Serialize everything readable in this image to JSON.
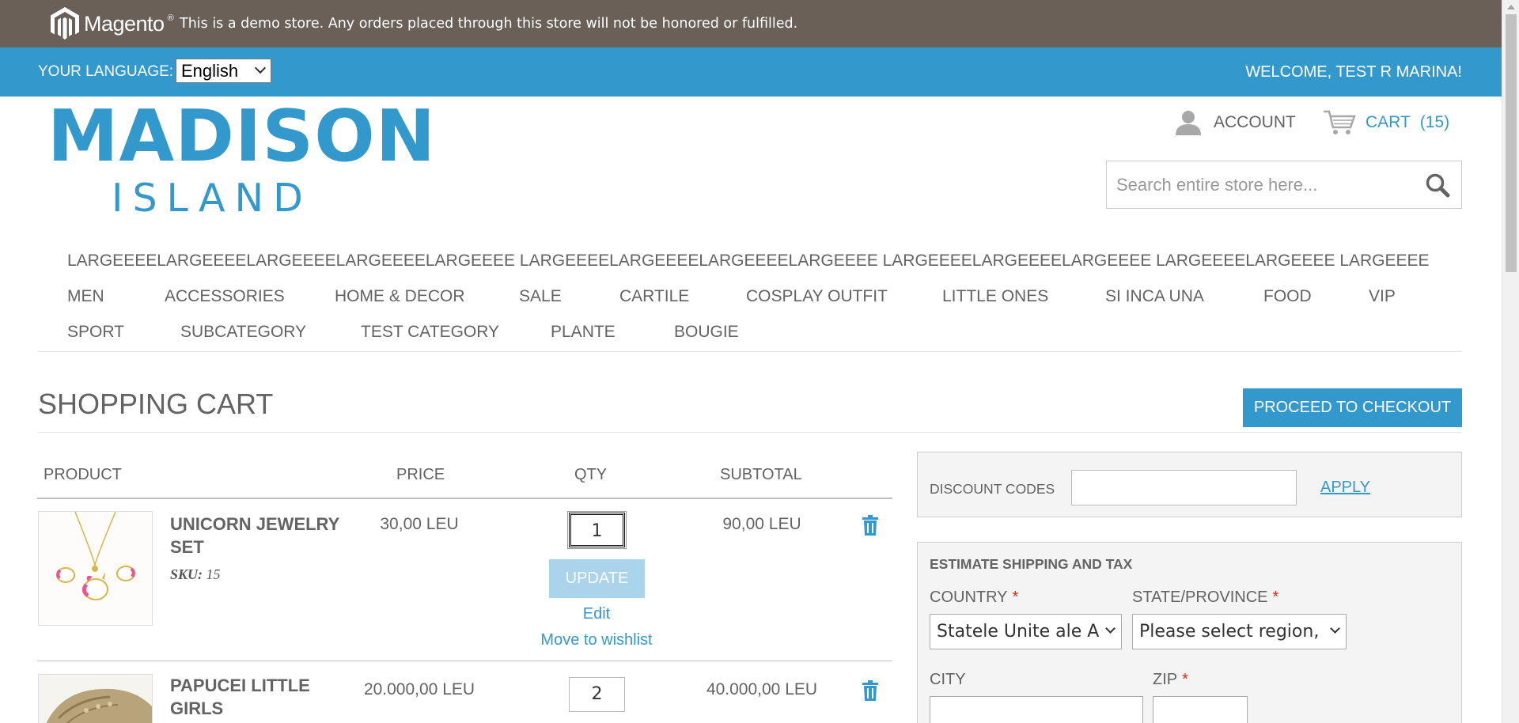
{
  "demo_notice": {
    "brand": "Magento",
    "text": "This is a demo store. Any orders placed through this store will not be honored or fulfilled."
  },
  "header_bar": {
    "language_label": "YOUR LANGUAGE:",
    "language_value": "English",
    "welcome": "WELCOME, TEST R MARINA!"
  },
  "logo": {
    "line1": "MADISON",
    "line2": "ISLAND"
  },
  "account": {
    "account_label": "ACCOUNT",
    "cart_label": "CART",
    "cart_count": "(15)"
  },
  "search": {
    "placeholder": "Search entire store here..."
  },
  "nav": {
    "row1": "LARGEEEELARGEEEELARGEEEELARGEEEELARGEEEE LARGEEEELARGEEEELARGEEEELARGEEEE LARGEEEELARGEEEELARGEEEE LARGEEEELARGEEEE LARGEEEE",
    "row2": [
      "MEN",
      "ACCESSORIES",
      "HOME & DECOR",
      "SALE",
      "CARTILE",
      "COSPLAY OUTFIT",
      "LITTLE ONES",
      "SI INCA UNA",
      "FOOD",
      "VIP"
    ],
    "row3": [
      "SPORT",
      "SUBCATEGORY",
      "TEST CATEGORY",
      "PLANTE",
      "BOUGIE"
    ]
  },
  "page": {
    "title": "SHOPPING CART",
    "checkout_button": "PROCEED TO CHECKOUT"
  },
  "cart_table": {
    "headers": [
      "PRODUCT",
      "PRICE",
      "QTY",
      "SUBTOTAL"
    ],
    "rows": [
      {
        "name": "UNICORN JEWELRY SET",
        "sku_label": "SKU:",
        "sku_value": "15",
        "price": "30,00 LEU",
        "qty": "1",
        "subtotal": "90,00 LEU",
        "update_label": "UPDATE",
        "edit_label": "Edit",
        "wishlist_label": "Move to wishlist"
      },
      {
        "name": "PAPUCEI LITTLE GIRLS",
        "price": "20.000,00 LEU",
        "qty": "2",
        "subtotal": "40.000,00 LEU"
      }
    ]
  },
  "discount": {
    "label": "DISCOUNT CODES",
    "apply": "APPLY",
    "value": ""
  },
  "shipping": {
    "title": "ESTIMATE SHIPPING AND TAX",
    "country_label": "COUNTRY",
    "country_value": "Statele Unite ale Americii",
    "state_label": "STATE/PROVINCE",
    "state_value": "Please select region, state or province",
    "city_label": "CITY",
    "zip_label": "ZIP",
    "required_mark": "*"
  },
  "colors": {
    "brand_blue": "#3399cc",
    "demo_bar": "#6a6057",
    "text_gray": "#636363",
    "required_red": "#df280a"
  }
}
